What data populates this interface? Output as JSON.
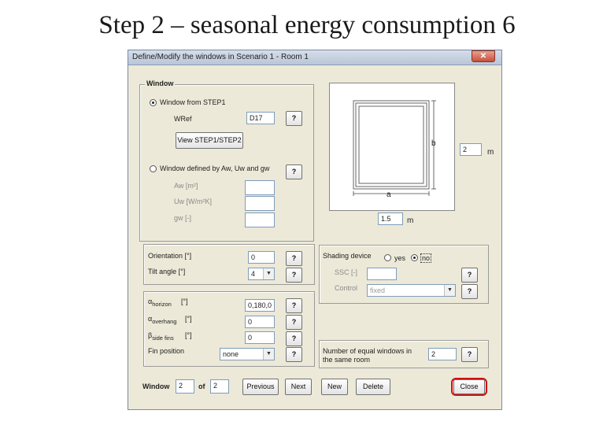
{
  "slide": {
    "title": "Step 2 – seasonal energy consumption 6"
  },
  "dialog": {
    "title": "Define/Modify the windows in Scenario 1 - Room 1",
    "close_glyph": "✕",
    "window_group": {
      "legend": "Window",
      "option_from_step1": "Window from STEP1",
      "wref_label": "WRef",
      "wref_value": "D17",
      "view_button": "View STEP1/STEP2",
      "option_defined": "Window defined by Aw, Uw and gw",
      "aw_label": "Aw [m²]",
      "uw_label": "Uw [W/m²K]",
      "gw_label": "gw [-]",
      "help": "?"
    },
    "diagram": {
      "b_label": "b",
      "b_value": "2",
      "b_unit": "m",
      "a_label": "a",
      "a_value": "1.5",
      "a_unit": "m"
    },
    "orientation": {
      "orientation_label": "Orientation  [°]",
      "orientation_value": "0",
      "tilt_label": "Tilt angle  [°]",
      "tilt_value": "4"
    },
    "obstructions": {
      "alpha_sym": "α",
      "horizon_sub": "horizon",
      "horizon_unit": "[°]",
      "horizon_value": "0,180,0",
      "overhang_sub": "overhang",
      "overhang_unit": "[°]",
      "overhang_value": "0",
      "beta_sym": "β",
      "fins_sub": "side fins",
      "fins_unit": "[°]",
      "fins_value": "0",
      "fin_position_label": "Fin position",
      "fin_position_value": "none"
    },
    "shading": {
      "label": "Shading device",
      "yes": "yes",
      "no": "no",
      "ssc_label": "SSC [-]",
      "control_label": "Control",
      "control_value": "fixed"
    },
    "equal_windows": {
      "label_line1": "Number of equal windows in",
      "label_line2": "the same room",
      "value": "2"
    },
    "footer": {
      "window_label": "Window",
      "window_value": "2",
      "of_label": "of",
      "of_value": "2",
      "previous": "Previous",
      "next": "Next",
      "new": "New",
      "delete": "Delete",
      "close": "Close"
    },
    "colors": {
      "highlight_ring": "#d01010",
      "title_bar": "#c6d1e0"
    }
  }
}
